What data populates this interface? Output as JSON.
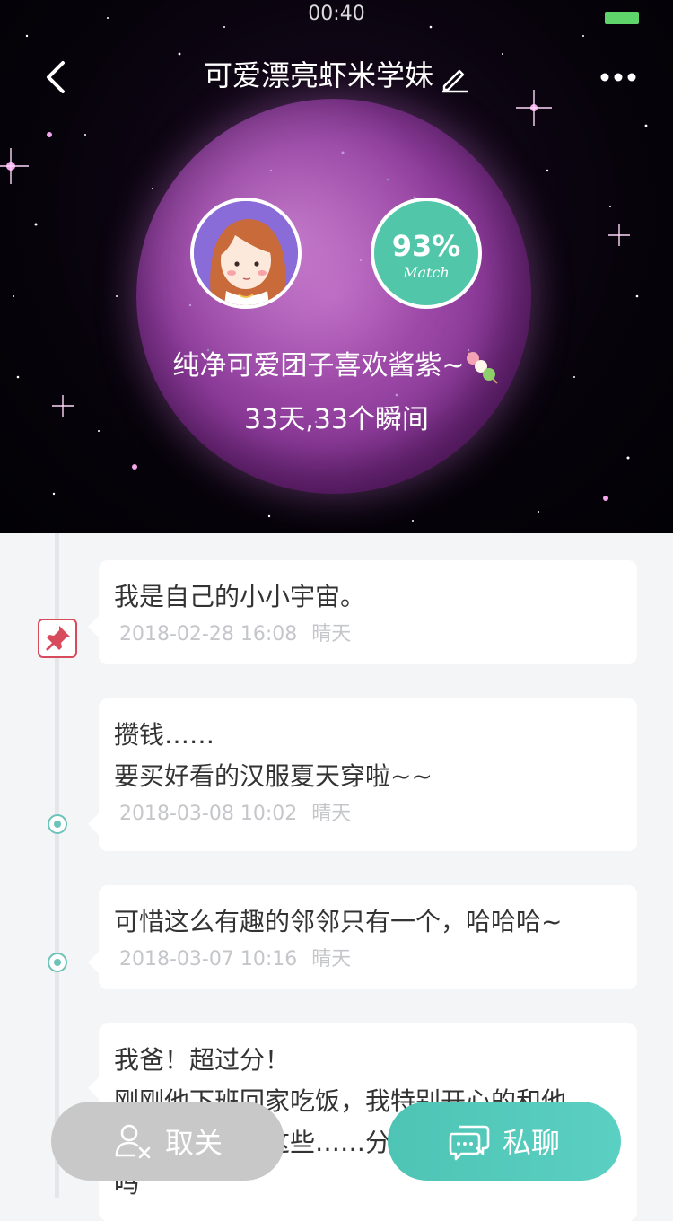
{
  "status_bar": {
    "time": "00:40"
  },
  "nav": {
    "title": "可爱漂亮虾米学妹"
  },
  "profile": {
    "match_percent": "93%",
    "match_label": "Match",
    "signature": "纯净可爱团子喜欢酱紫~",
    "stats": "33天,33个瞬间"
  },
  "posts": [
    {
      "text": "我是自己的小小宇宙。",
      "date": "2018-02-28 16:08",
      "weather": "晴天",
      "pinned": true
    },
    {
      "text": "攒钱……\n要买好看的汉服夏天穿啦~~",
      "date": "2018-03-08 10:02",
      "weather": "晴天",
      "pinned": false
    },
    {
      "text": "可惜这么有趣的邻邻只有一个，哈哈哈~",
      "date": "2018-03-07 10:16",
      "weather": "晴天",
      "pinned": false
    },
    {
      "text": "我爸！超过分！\n刚刚他下班回家吃饭，我特别开心的和他\n说……吃吗？这些……分\n吗",
      "date": "",
      "weather": "",
      "pinned": false
    }
  ],
  "actions": {
    "unfollow": "取关",
    "chat": "私聊"
  },
  "colors": {
    "accent": "#52c6a9",
    "pin": "#d84b5d",
    "unfollow_bg": "#c8c8c8"
  }
}
